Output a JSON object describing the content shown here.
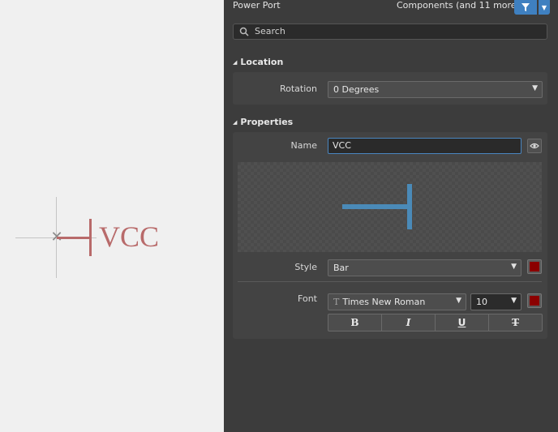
{
  "canvas": {
    "component_label": "VCC",
    "symbol_color": "#b86a6a"
  },
  "panel": {
    "title": "Power Port",
    "filter_text": "Components (and 11 more)",
    "filter_icon": "funnel-icon",
    "search": {
      "placeholder": "Search"
    }
  },
  "location": {
    "header": "Location",
    "rotation_label": "Rotation",
    "rotation_value": "0 Degrees"
  },
  "properties": {
    "header": "Properties",
    "name_label": "Name",
    "name_value": "VCC",
    "preview_color": "#4a8ab8",
    "style_label": "Style",
    "style_value": "Bar",
    "style_color": "#8b0000",
    "font_label": "Font",
    "font_family_value": "Times New Roman",
    "font_glyph": "T",
    "font_size_value": "10",
    "font_color": "#8b0000",
    "format_buttons": [
      "B",
      "I",
      "U",
      "T"
    ]
  }
}
